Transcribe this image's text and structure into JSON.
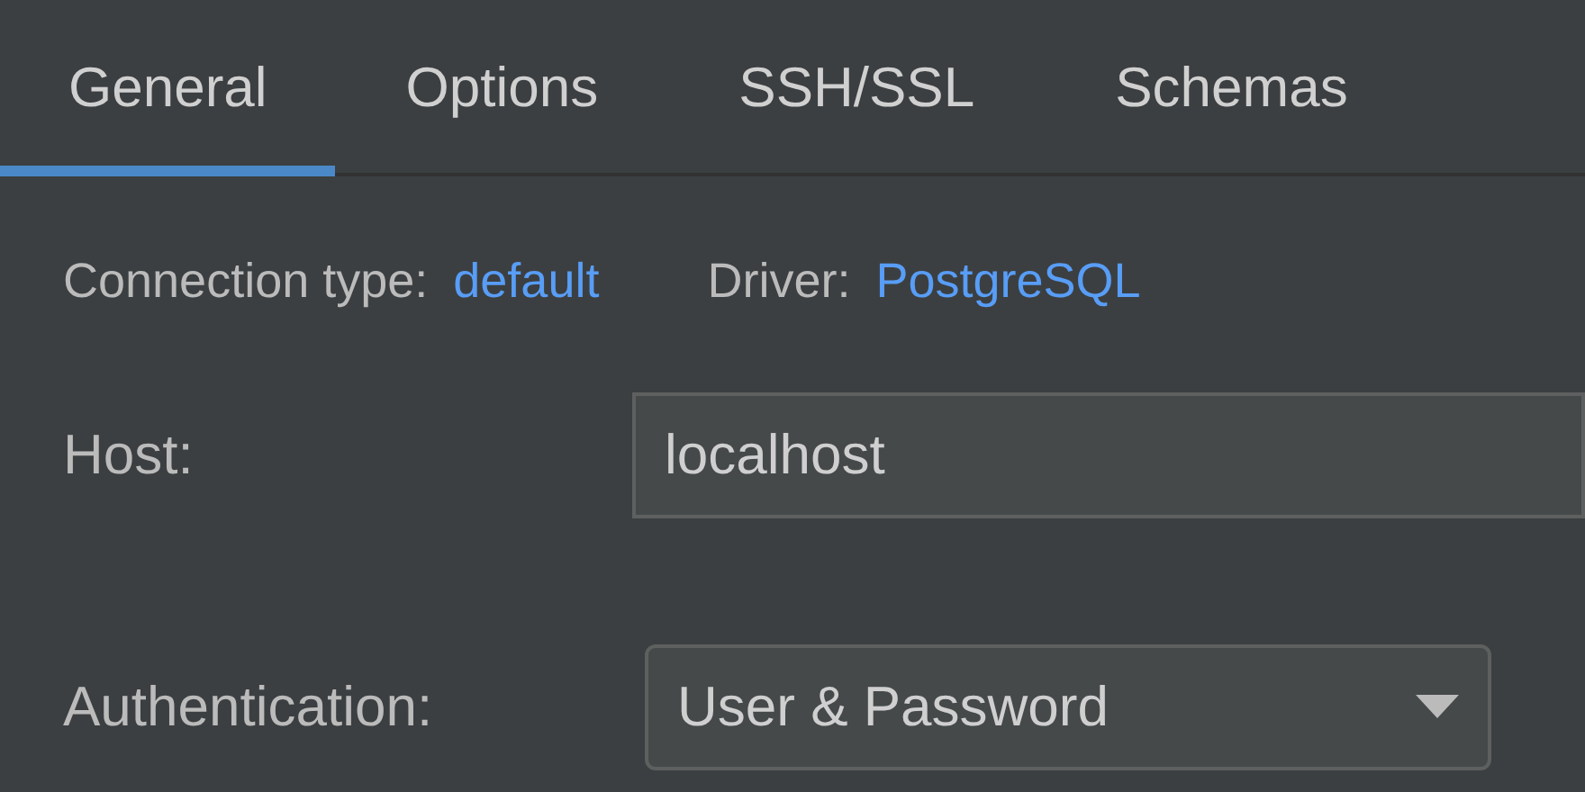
{
  "tabs": [
    {
      "label": "General",
      "selected": true
    },
    {
      "label": "Options",
      "selected": false
    },
    {
      "label": "SSH/SSL",
      "selected": false
    },
    {
      "label": "Schemas",
      "selected": false
    }
  ],
  "connection": {
    "type_label": "Connection type:",
    "type_value": "default",
    "driver_label": "Driver:",
    "driver_value": "PostgreSQL"
  },
  "host": {
    "label": "Host:",
    "value": "localhost"
  },
  "authentication": {
    "label": "Authentication:",
    "value": "User & Password"
  }
}
